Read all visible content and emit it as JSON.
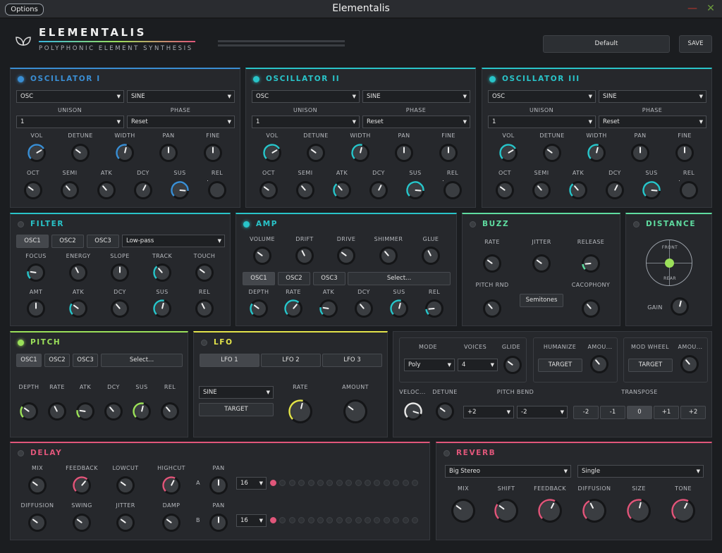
{
  "titlebar": {
    "options": "Options",
    "title": "Elementalis",
    "min": "—",
    "close": "✕"
  },
  "header": {
    "brand": "ELEMENTALIS",
    "subtitle": "POLYPHONIC ELEMENT SYNTHESIS",
    "preset": "Default",
    "save": "SAVE"
  },
  "colors": {
    "blue": "#3a8ed3",
    "teal": "#29c4c9",
    "green": "#9be05a",
    "yellow": "#e2e34a",
    "red": "#e0567a",
    "mint": "#5fdca0"
  },
  "osc": [
    {
      "title": "OSCILLATOR I",
      "source": "OSC",
      "wave": "SINE",
      "unison_label": "UNISON",
      "phase_label": "PHASE",
      "unison": "1",
      "phase": "Reset"
    },
    {
      "title": "OSCILLATOR II",
      "source": "OSC",
      "wave": "SINE",
      "unison_label": "UNISON",
      "phase_label": "PHASE",
      "unison": "1",
      "phase": "Reset"
    },
    {
      "title": "OSCILLATOR III",
      "source": "OSC",
      "wave": "SINE",
      "unison_label": "UNISON",
      "phase_label": "PHASE",
      "unison": "1",
      "phase": "Reset"
    }
  ],
  "osc_knobs": [
    "VOL",
    "DETUNE",
    "WIDTH",
    "PAN",
    "FINE",
    "OCT",
    "SEMI",
    "ATK",
    "DCY",
    "SUS",
    "REL"
  ],
  "filter": {
    "title": "FILTER",
    "tabs": [
      "OSC1",
      "OSC2",
      "OSC3"
    ],
    "type": "Low-pass",
    "knobs": [
      "FOCUS",
      "ENERGY",
      "SLOPE",
      "TRACK",
      "TOUCH",
      "AMT",
      "ATK",
      "DCY",
      "SUS",
      "REL"
    ]
  },
  "amp": {
    "title": "AMP",
    "top": [
      "VOLUME",
      "DRIFT",
      "DRIVE",
      "SHIMMER",
      "GLUE"
    ],
    "tabs": [
      "OSC1",
      "OSC2",
      "OSC3"
    ],
    "select": "Select...",
    "bottom": [
      "DEPTH",
      "RATE",
      "ATK",
      "DCY",
      "SUS",
      "REL"
    ]
  },
  "buzz": {
    "title": "BUZZ",
    "knobs": [
      "RATE",
      "JITTER",
      "RELEASE",
      "PITCH RND",
      "CACOPHONY"
    ],
    "button": "Semitones"
  },
  "distance": {
    "title": "DISTANCE",
    "front": "FRONT",
    "rear": "REAR",
    "gain": "GAIN"
  },
  "pitch": {
    "title": "PITCH",
    "tabs": [
      "OSC1",
      "OSC2",
      "OSC3"
    ],
    "select": "Select...",
    "knobs": [
      "DEPTH",
      "RATE",
      "ATK",
      "DCY",
      "SUS",
      "REL"
    ]
  },
  "lfo": {
    "title": "LFO",
    "tabs": [
      "LFO 1",
      "LFO 2",
      "LFO 3"
    ],
    "wave": "SINE",
    "target": "TARGET",
    "rate": "RATE",
    "amount": "AMOUNT"
  },
  "voice": {
    "mode_label": "MODE",
    "mode": "Poly",
    "voices_label": "VOICES",
    "voices": "4",
    "glide": "GLIDE",
    "humanize": "HUMANIZE",
    "amount1": "AMOU...",
    "target1": "TARGET",
    "modwheel": "MOD WHEEL",
    "amount2": "AMOU...",
    "target2": "TARGET",
    "velocity": "VELOC...",
    "detune": "DETUNE",
    "pitchbend": "PITCH BEND",
    "pb_up": "+2",
    "pb_down": "-2",
    "transpose": "TRANSPOSE",
    "transpose_vals": [
      "-2",
      "-1",
      "0",
      "+1",
      "+2"
    ]
  },
  "delay": {
    "title": "DELAY",
    "top": [
      "MIX",
      "FEEDBACK",
      "LOWCUT",
      "HIGHCUT"
    ],
    "bottom": [
      "DIFFUSION",
      "SWING",
      "JITTER",
      "DAMP"
    ],
    "pan": "PAN",
    "a": "A",
    "b": "B",
    "steps_a": "16",
    "steps_b": "16"
  },
  "reverb": {
    "title": "REVERB",
    "type": "Big Stereo",
    "mode": "Single",
    "knobs": [
      "MIX",
      "SHIFT",
      "FEEDBACK",
      "DIFFUSION",
      "SIZE",
      "TONE"
    ]
  }
}
